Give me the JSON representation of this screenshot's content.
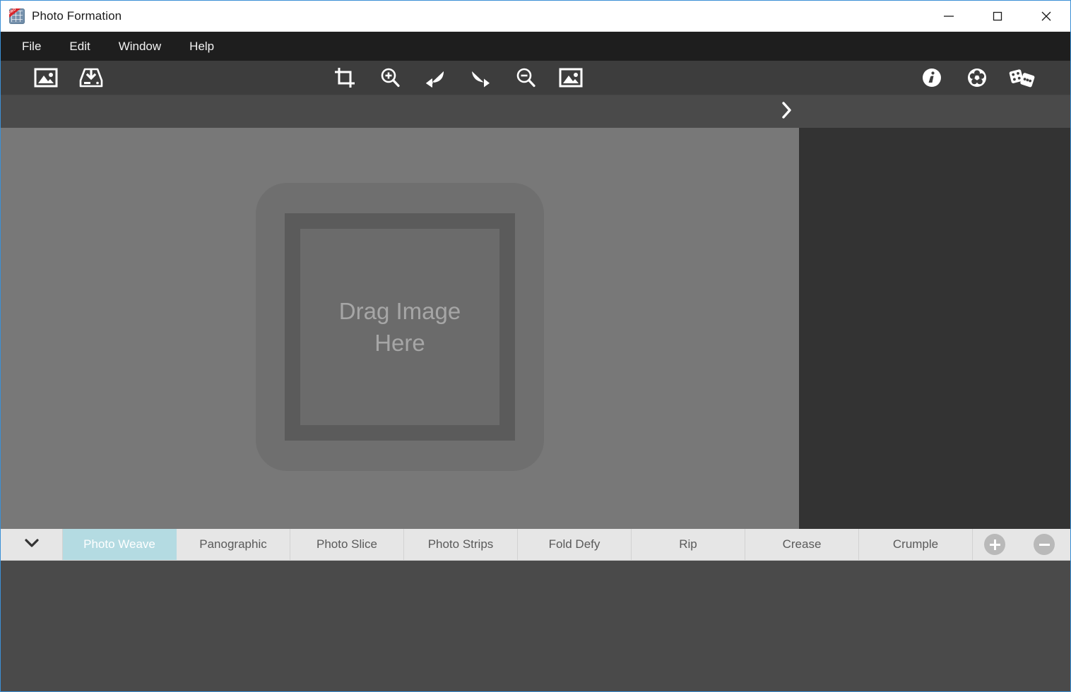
{
  "window": {
    "title": "Photo Formation",
    "app_icon": "app-grid-pro-icon",
    "controls": {
      "minimize": "minimize-button",
      "maximize": "maximize-button",
      "close": "close-button"
    },
    "accent_border_color": "#3b90d6"
  },
  "menubar": {
    "items": [
      {
        "label": "File"
      },
      {
        "label": "Edit"
      },
      {
        "label": "Window"
      },
      {
        "label": "Help"
      }
    ]
  },
  "toolbar": {
    "left": [
      {
        "name": "open-image-icon",
        "title": "Open Image"
      },
      {
        "name": "save-image-icon",
        "title": "Save Image"
      }
    ],
    "center": [
      {
        "name": "crop-icon",
        "title": "Crop"
      },
      {
        "name": "zoom-in-icon",
        "title": "Zoom In"
      },
      {
        "name": "undo-icon",
        "title": "Undo"
      },
      {
        "name": "redo-icon",
        "title": "Redo"
      },
      {
        "name": "zoom-out-icon",
        "title": "Zoom Out"
      },
      {
        "name": "fit-image-icon",
        "title": "Fit Image"
      }
    ],
    "right": [
      {
        "name": "info-icon",
        "title": "Info"
      },
      {
        "name": "effects-icon",
        "title": "Effects"
      },
      {
        "name": "randomize-dice-icon",
        "title": "Randomize"
      }
    ]
  },
  "subbar": {
    "expand_icon": "chevron-right-icon"
  },
  "canvas": {
    "dropzone_text": "Drag Image\nHere",
    "dropzone_line1": "Drag Image",
    "dropzone_line2": "Here",
    "background_color": "#787878",
    "right_pane_color": "#333333"
  },
  "tabbar": {
    "collapse_icon": "chevron-down-icon",
    "active_tab": "Photo Weave",
    "active_color": "#b4dbe2",
    "tabs": [
      {
        "label": "Photo Weave",
        "active": true
      },
      {
        "label": "Panographic",
        "active": false
      },
      {
        "label": "Photo Slice",
        "active": false
      },
      {
        "label": "Photo Strips",
        "active": false
      },
      {
        "label": "Fold Defy",
        "active": false
      },
      {
        "label": "Rip",
        "active": false
      },
      {
        "label": "Crease",
        "active": false
      },
      {
        "label": "Crumple",
        "active": false
      }
    ],
    "actions": [
      {
        "name": "add-tab-button",
        "glyph": "+"
      },
      {
        "name": "remove-tab-button",
        "glyph": "−"
      }
    ]
  },
  "bottom_panel": {
    "background_color": "#4a4a4a"
  }
}
